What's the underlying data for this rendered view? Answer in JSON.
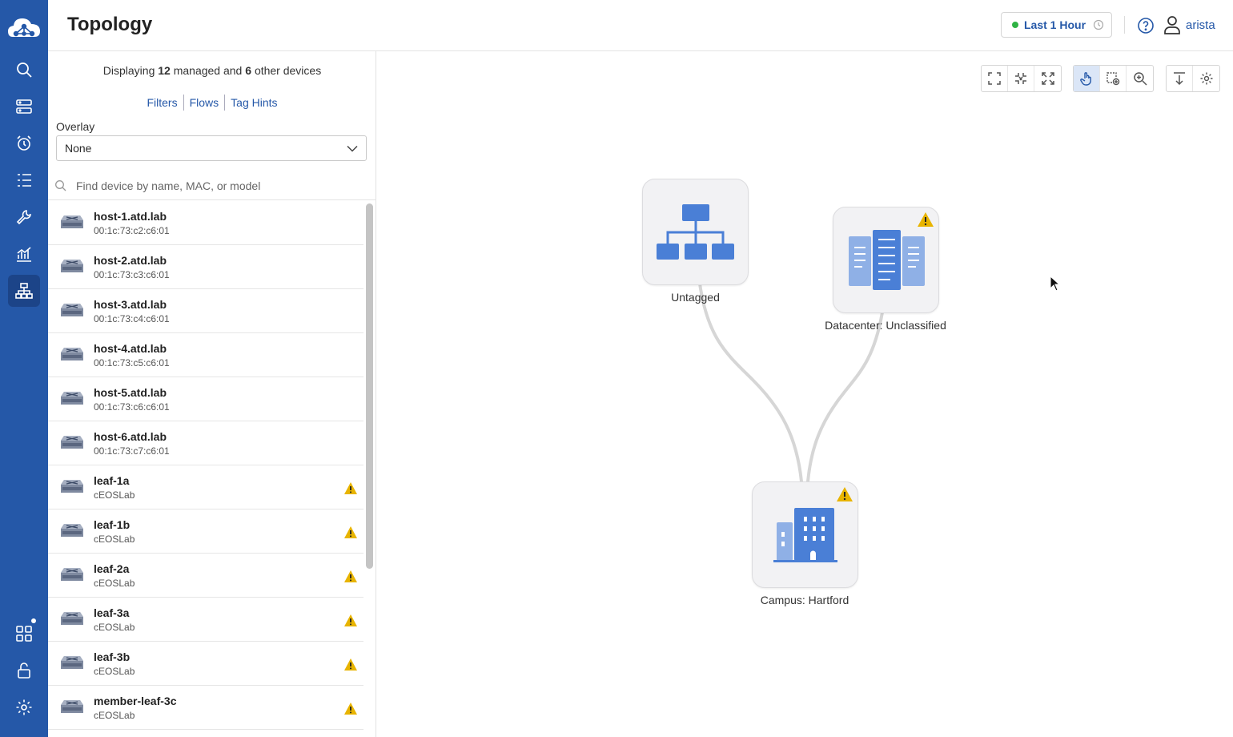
{
  "header": {
    "title": "Topology",
    "time_range": "Last 1 Hour",
    "user": "arista"
  },
  "panel": {
    "summary": {
      "prefix": "Displaying",
      "managed_count": "12",
      "middle": "managed and",
      "other_count": "6",
      "suffix": "other devices"
    },
    "links": [
      "Filters",
      "Flows",
      "Tag Hints"
    ],
    "overlay_label": "Overlay",
    "overlay_value": "None",
    "search_placeholder": "Find device by name, MAC, or model"
  },
  "devices": [
    {
      "name": "host-1.atd.lab",
      "sub": "00:1c:73:c2:c6:01",
      "warning": false
    },
    {
      "name": "host-2.atd.lab",
      "sub": "00:1c:73:c3:c6:01",
      "warning": false
    },
    {
      "name": "host-3.atd.lab",
      "sub": "00:1c:73:c4:c6:01",
      "warning": false
    },
    {
      "name": "host-4.atd.lab",
      "sub": "00:1c:73:c5:c6:01",
      "warning": false
    },
    {
      "name": "host-5.atd.lab",
      "sub": "00:1c:73:c6:c6:01",
      "warning": false
    },
    {
      "name": "host-6.atd.lab",
      "sub": "00:1c:73:c7:c6:01",
      "warning": false
    },
    {
      "name": "leaf-1a",
      "sub": "cEOSLab",
      "warning": true
    },
    {
      "name": "leaf-1b",
      "sub": "cEOSLab",
      "warning": true
    },
    {
      "name": "leaf-2a",
      "sub": "cEOSLab",
      "warning": true
    },
    {
      "name": "leaf-3a",
      "sub": "cEOSLab",
      "warning": true
    },
    {
      "name": "leaf-3b",
      "sub": "cEOSLab",
      "warning": true
    },
    {
      "name": "member-leaf-3c",
      "sub": "cEOSLab",
      "warning": true
    }
  ],
  "topology": {
    "nodes": [
      {
        "id": "untagged",
        "label": "Untagged",
        "icon": "network-hierarchy-icon",
        "warning": false
      },
      {
        "id": "datacenter",
        "label": "Datacenter: Unclassified",
        "icon": "datacenter-icon",
        "warning": true
      },
      {
        "id": "campus",
        "label": "Campus: Hartford",
        "icon": "campus-building-icon",
        "warning": true
      }
    ],
    "edges": [
      {
        "from": "untagged",
        "to": "campus"
      },
      {
        "from": "datacenter",
        "to": "campus"
      }
    ]
  },
  "colors": {
    "rail": "#2558a8",
    "accent": "#2558a8",
    "warning": "#e8b400",
    "live": "#2fb344",
    "node_icon": "#4a7fd6"
  }
}
